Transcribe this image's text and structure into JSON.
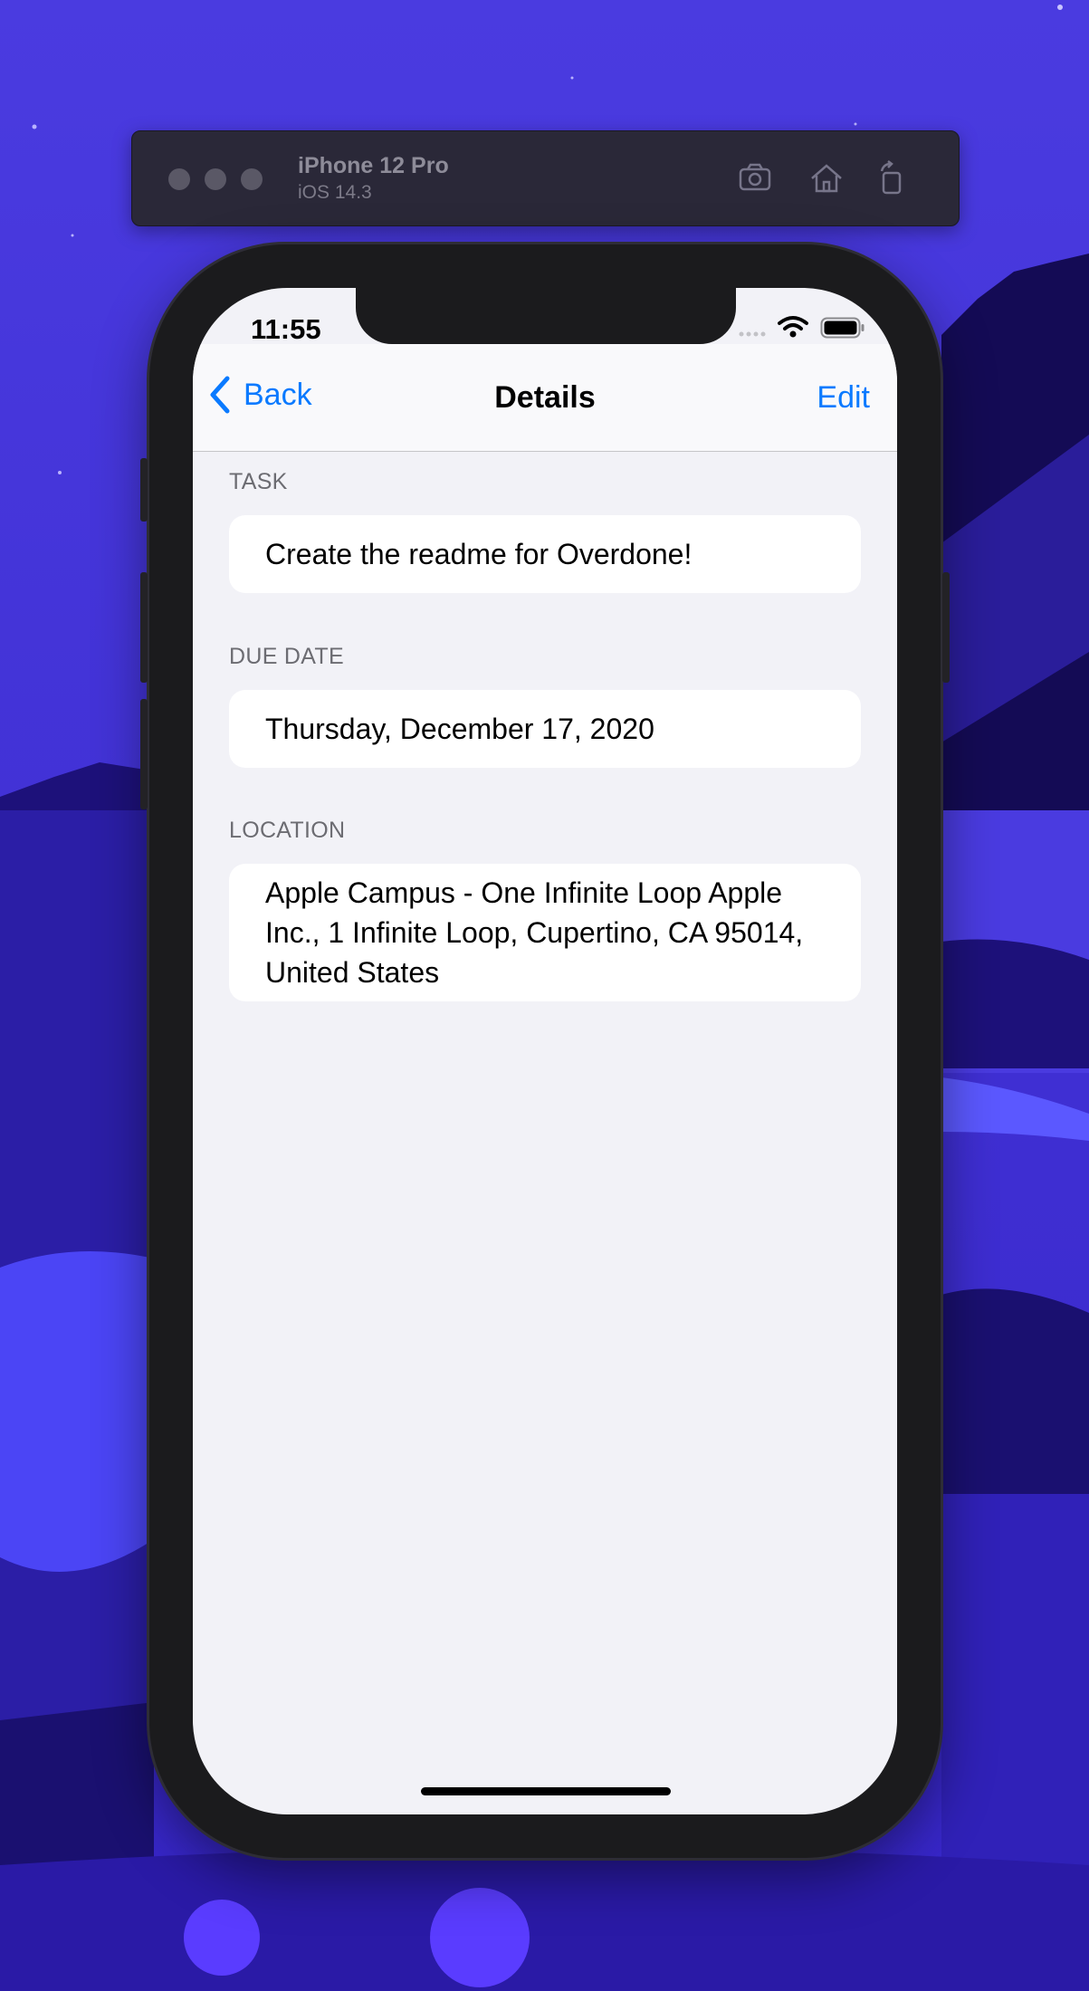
{
  "simulator": {
    "device_name": "iPhone 12 Pro",
    "os_version": "iOS 14.3",
    "toolbar_icons": [
      "screenshot-icon",
      "home-icon",
      "rotate-icon"
    ]
  },
  "status_bar": {
    "time": "11:55",
    "icons": [
      "cellular-icon",
      "wifi-icon",
      "battery-icon"
    ]
  },
  "nav": {
    "back_label": "Back",
    "title": "Details",
    "edit_label": "Edit"
  },
  "sections": {
    "task": {
      "header": "TASK",
      "value": "Create the readme for Overdone!"
    },
    "due_date": {
      "header": "DUE DATE",
      "value": "Thursday, December 17, 2020"
    },
    "location": {
      "header": "LOCATION",
      "value": "Apple Campus - One Infinite Loop Apple Inc., 1 Infinite Loop, Cupertino, CA 95014, United States"
    }
  },
  "colors": {
    "accent": "#0a7aff",
    "screen_background": "#f2f2f7",
    "wallpaper": "#3d2fd6"
  }
}
